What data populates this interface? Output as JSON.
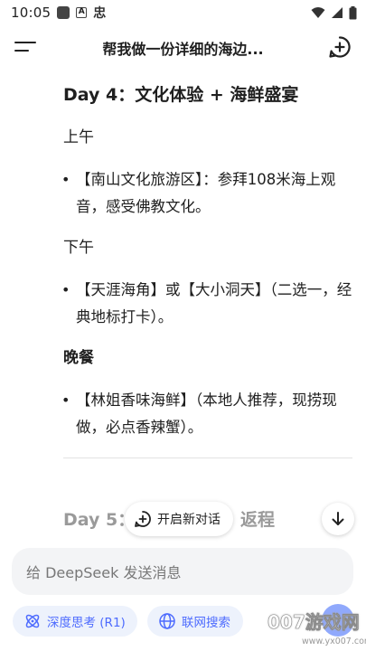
{
  "status_bar": {
    "time": "10:05",
    "zhong_glyph": "忠",
    "a_glyph": "A",
    "icons": [
      "square-app-icon",
      "a-notification-icon",
      "wifi-icon",
      "signal-icon",
      "battery-icon"
    ]
  },
  "header": {
    "title": "帮我做一份详细的海边...",
    "menu_icon": "menu-icon",
    "new_chat_icon": "plus-circle-icon"
  },
  "message": {
    "day_heading": "Day 4：文化体验 + 海鲜盛宴",
    "sections": [
      {
        "label": "上午",
        "bold": false,
        "bullet": "【南山文化旅游区】：参拜108米海上观音，感受佛教文化。"
      },
      {
        "label": "下午",
        "bold": false,
        "bullet": "【天涯海角】或【大小洞天】（二选一，经典地标打卡）。"
      },
      {
        "label": "晚餐",
        "bold": true,
        "bullet": "【林姐香味海鲜】（本地人推荐，现捞现做，必点香辣蟹）。"
      }
    ],
    "next_day_partial": "Day 5：",
    "next_day_tail": "返程"
  },
  "floating": {
    "new_dialog_label": "开启新对话",
    "scroll_down_icon": "arrow-down-icon"
  },
  "composer": {
    "placeholder": "给 DeepSeek 发送消息",
    "deep_think_label": "深度思考 (R1)",
    "web_search_label": "联网搜索"
  },
  "watermark": {
    "big": "007游戏网",
    "small": "www.yx007.com"
  },
  "colors": {
    "accent": "#4d6bfe",
    "chip_bg": "#edf2fc",
    "input_bg": "#f3f4f6",
    "faded_text": "#9a9a9a"
  }
}
